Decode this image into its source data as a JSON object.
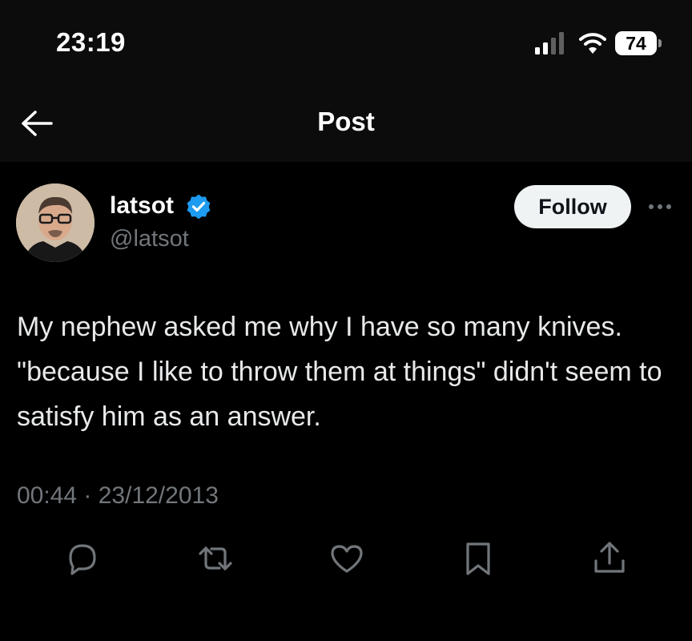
{
  "status_bar": {
    "time": "23:19",
    "battery_level": "74",
    "icons": [
      "cellular-signal-icon",
      "wifi-icon",
      "battery-icon"
    ]
  },
  "header": {
    "title": "Post",
    "back_icon": "arrow-left-icon"
  },
  "author": {
    "display_name": "latsot",
    "handle": "@latsot",
    "verified": true,
    "verified_color": "#1d9bf0"
  },
  "follow_button": {
    "label": "Follow"
  },
  "more_icon": "more-horizontal-icon",
  "post": {
    "text": "My nephew asked me why I have so many knives. \"because I like to throw them at things\" didn't seem to satisfy him as an answer.",
    "timestamp": "00:44 · 23/12/2013"
  },
  "actions": [
    "reply-icon",
    "repost-icon",
    "like-icon",
    "bookmark-icon",
    "share-icon"
  ],
  "colors": {
    "background": "#000000",
    "header_background": "#0c0c0c",
    "primary_text": "#e7e9ea",
    "secondary_text": "#71767b",
    "accent": "#1d9bf0"
  }
}
